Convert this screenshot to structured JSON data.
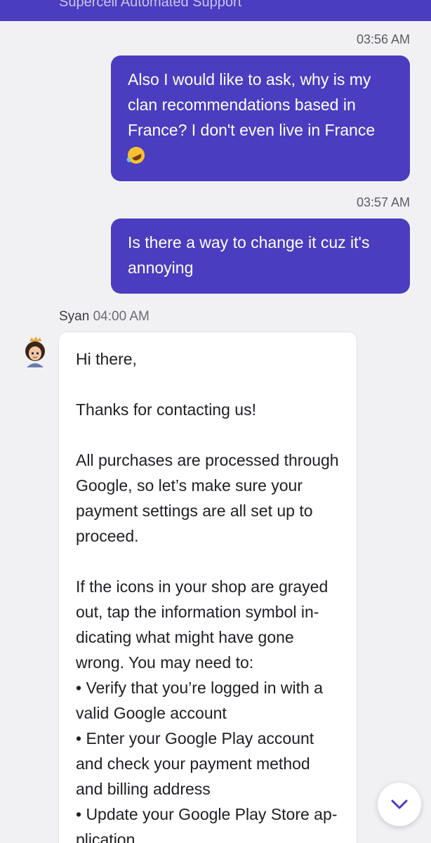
{
  "header": {
    "title": "Supercell Automated Support"
  },
  "messages": {
    "msg1": {
      "time": "03:56 AM",
      "text": "Also I would like to ask, why is my clan recommendations based in France? I don't even live in France"
    },
    "msg2": {
      "time": "03:57 AM",
      "text": "Is there a way to change it cuz it's annoying"
    },
    "agent": {
      "name": "Syan",
      "time": "04:00 AM",
      "greeting": "Hi there,",
      "thanks": "Thanks for contacting us!",
      "para1": "All purchases are processed through Google, so let’s make sure your payment settings are all set up to proceed.",
      "para2": "If the icons in your shop are grayed out, tap the information symbol in­dicating what might have gone wrong. You may need to:",
      "bullet1": "• Verify that you’re logged in with a valid Google account",
      "bullet2": "• Enter your Google Play account and check your payment method and billing address",
      "bullet3": "• Update your Google Play Store ap­plication"
    }
  },
  "icons": {
    "emoji": "rolling-on-floor-laughing",
    "scroll": "chevron-down-icon",
    "accent": "#4a3dbf"
  }
}
